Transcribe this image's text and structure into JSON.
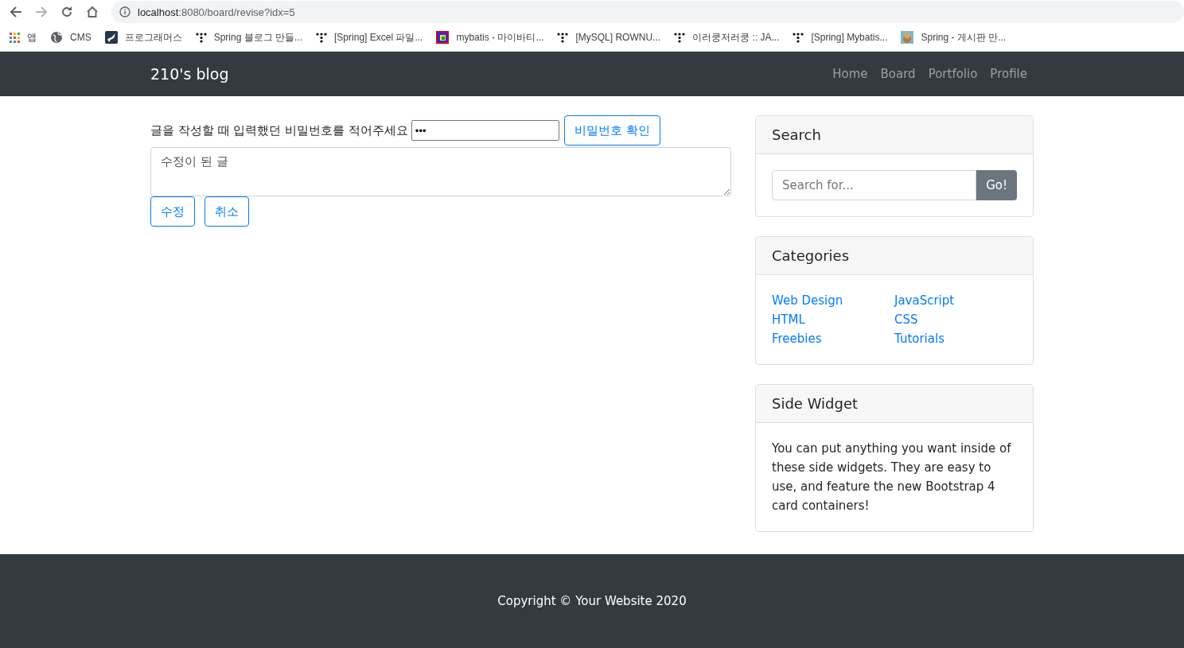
{
  "browser": {
    "url_host": "localhost",
    "url_rest": ":8080/board/revise?idx=5"
  },
  "bookmarks": [
    {
      "kind": "apps",
      "label": "앱"
    },
    {
      "kind": "globe",
      "label": "CMS"
    },
    {
      "kind": "bird",
      "label": "프로그래머스"
    },
    {
      "kind": "dots",
      "label": "Spring 블로그 만들..."
    },
    {
      "kind": "dots",
      "label": "[Spring] Excel 파일..."
    },
    {
      "kind": "square",
      "label": "mybatis - 마이바티..."
    },
    {
      "kind": "dots",
      "label": "[MySQL] ROWNU..."
    },
    {
      "kind": "dots",
      "label": "이러쿵저러쿵 :: JA..."
    },
    {
      "kind": "dots",
      "label": "[Spring] Mybatis..."
    },
    {
      "kind": "picture",
      "label": "Spring - 게시판 만..."
    }
  ],
  "navbar": {
    "brand": "210's blog",
    "links": [
      "Home",
      "Board",
      "Portfolio",
      "Profile"
    ]
  },
  "form": {
    "prompt": "글을 작성할 때 입력했던 비밀번호를 적어주세요",
    "password": "•••",
    "check_button": "비밀번호 확인",
    "content": "수정이 된 글",
    "buttons": [
      "수정",
      "취소"
    ]
  },
  "search": {
    "title": "Search",
    "placeholder": "Search for...",
    "button": "Go!"
  },
  "categories": {
    "title": "Categories",
    "columns": [
      [
        "Web Design",
        "HTML",
        "Freebies"
      ],
      [
        "JavaScript",
        "CSS",
        "Tutorials"
      ]
    ]
  },
  "side_widget": {
    "title": "Side Widget",
    "text": "You can put anything you want inside of these side widgets. They are easy to use, and feature the new Bootstrap 4 card containers!"
  },
  "footer": {
    "text": "Copyright © Your Website 2020"
  }
}
